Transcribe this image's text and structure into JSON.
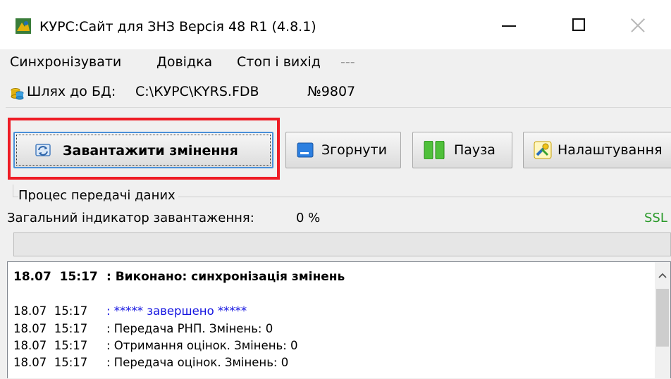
{
  "window": {
    "title": "КУРС:Сайт для ЗНЗ   Версія 48 R1 (4.8.1)",
    "icon": "kurs-app-icon"
  },
  "menu": {
    "items": [
      "Синхронізувати",
      "Довідка",
      "Стоп і вихід",
      "---"
    ]
  },
  "db": {
    "label": "Шлях до БД:",
    "path": "C:\\КУРС\\KYRS.FDB",
    "number": "№9807"
  },
  "toolbar": {
    "load_label": "Завантажити змінення",
    "collapse_label": "Згорнути",
    "pause_label": "Пауза",
    "settings_label": "Налаштування"
  },
  "progress": {
    "group_title": "Процес передачі даних",
    "label": "Загальний індикатор завантаження:",
    "value_text": "0 %",
    "value": 0,
    "ssl": "SSL"
  },
  "log": [
    {
      "time": "18.07  15:17",
      "msg": ": Виконано: синхронізація змінень",
      "style": "bold"
    },
    {
      "time": "18.07  15:17",
      "msg": ": ***** завершено *****",
      "style": "blue"
    },
    {
      "time": "18.07  15:17",
      "msg": ": Передача РНП. Змінень: 0",
      "style": "normal"
    },
    {
      "time": "18.07  15:17",
      "msg": ": Отримання оцінок. Змінень: 0",
      "style": "normal"
    },
    {
      "time": "18.07  15:17",
      "msg": ": Передача оцінок. Змінень: 0",
      "style": "normal"
    }
  ],
  "colors": {
    "highlight": "#ee1c25",
    "ssl": "#2a9a2a",
    "log_blue": "#1414e0"
  }
}
